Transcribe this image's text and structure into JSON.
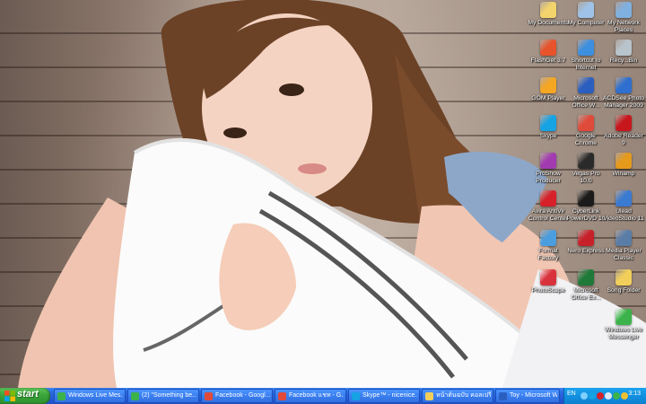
{
  "desktop_icons": [
    {
      "key": "my-documents",
      "label": "My Documents",
      "icon": "folder-documents-icon",
      "color": "#f3d36b"
    },
    {
      "key": "my-computer",
      "label": "My Computer",
      "icon": "computer-icon",
      "color": "#9fc3e8"
    },
    {
      "key": "my-network-places",
      "label": "My Network\nPlaces",
      "icon": "network-icon",
      "color": "#7fb0e0"
    },
    {
      "key": "flashget",
      "label": "FlashGet 3.7",
      "icon": "flashget-icon",
      "color": "#e8532b"
    },
    {
      "key": "shortcut-internet",
      "label": "Shortcut to\nInternet",
      "icon": "internet-explorer-icon",
      "color": "#3d8fe0"
    },
    {
      "key": "recycle-bin",
      "label": "Recy...Bin",
      "icon": "recycle-bin-icon",
      "color": "#b8c4cc"
    },
    {
      "key": "gom-player",
      "label": "GOM Player",
      "icon": "gom-player-icon",
      "color": "#f5a623"
    },
    {
      "key": "microsoft-office",
      "label": "Microsoft\nOffice W...",
      "icon": "word-icon",
      "color": "#2b5fbf"
    },
    {
      "key": "acdsee",
      "label": "ACDSee Photo\nManager 2009",
      "icon": "acdsee-icon",
      "color": "#2f6fcf"
    },
    {
      "key": "skype",
      "label": "Skype",
      "icon": "skype-icon",
      "color": "#16a3e4"
    },
    {
      "key": "google-chrome",
      "label": "Google\nChrome",
      "icon": "chrome-icon",
      "color": "#e04a3a"
    },
    {
      "key": "adobe-reader",
      "label": "Adobe Reader\n9",
      "icon": "adobe-reader-icon",
      "color": "#c8161d"
    },
    {
      "key": "proshow",
      "label": "ProShow\nProducer",
      "icon": "proshow-icon",
      "color": "#a23bb0"
    },
    {
      "key": "vegas-pro",
      "label": "Vegas Pro\n10.0",
      "icon": "vegas-icon",
      "color": "#2a2a2a"
    },
    {
      "key": "winamp",
      "label": "Winamp",
      "icon": "winamp-icon",
      "color": "#e59a1c"
    },
    {
      "key": "avira",
      "label": "Avira AntiVir\nControl Center",
      "icon": "avira-icon",
      "color": "#d7202a"
    },
    {
      "key": "cyberlink",
      "label": "CyberLink\nPowerDVD 10",
      "icon": "powerdvd-icon",
      "color": "#1b1b1b"
    },
    {
      "key": "ulead",
      "label": "Ulead\nVideoStudio 11",
      "icon": "ulead-icon",
      "color": "#3a7ad0"
    },
    {
      "key": "format-factory",
      "label": "Format\nFactory",
      "icon": "format-factory-icon",
      "color": "#4a9ee0"
    },
    {
      "key": "nero-express",
      "label": "Nero Express",
      "icon": "nero-icon",
      "color": "#c8202a"
    },
    {
      "key": "media-player-classic",
      "label": "Media Player\nClassic",
      "icon": "media-player-icon",
      "color": "#5a7da8"
    },
    {
      "key": "photoscape",
      "label": "PhotoScape",
      "icon": "photoscape-icon",
      "color": "#d8323c"
    },
    {
      "key": "microsoft-office-excel",
      "label": "Microsoft\nOffice Ex...",
      "icon": "excel-icon",
      "color": "#1f7a3a"
    },
    {
      "key": "song-folder",
      "label": "Song Folder",
      "icon": "folder-icon",
      "color": "#f1cf5a"
    },
    {
      "key": "windows-live-messenger",
      "label": "Windows Live\nMessenger",
      "icon": "messenger-icon",
      "color": "#3cb34a"
    }
  ],
  "taskbar": {
    "start_label": "start",
    "tasks": [
      {
        "label": "Windows Live Mes...",
        "icon": "messenger-icon",
        "color": "#3cb34a",
        "active": false
      },
      {
        "label": "(2) \"Something be...",
        "icon": "messenger-chat-icon",
        "color": "#3cb34a",
        "active": false
      },
      {
        "label": "Facebook - Googl...",
        "icon": "chrome-icon",
        "color": "#e04a3a",
        "active": false
      },
      {
        "label": "Facebook แชท - G...",
        "icon": "chrome-icon",
        "color": "#e04a3a",
        "active": false
      },
      {
        "label": "Skype™ - nicenice...",
        "icon": "skype-icon",
        "color": "#16a3e4",
        "active": false
      },
      {
        "label": "หน้าต้นฉบับ คอลเปรีชั่นจัก...",
        "icon": "folder-icon",
        "color": "#f1cf5a",
        "active": false
      },
      {
        "label": "Toy - Microsoft Word",
        "icon": "word-icon",
        "color": "#2b5fbf",
        "active": false
      }
    ],
    "tray": {
      "language": "EN",
      "icons": [
        {
          "name": "network-tray-icon",
          "color": "#7fd0ff"
        },
        {
          "name": "skype-tray-icon",
          "color": "#16a3e4"
        },
        {
          "name": "avira-tray-icon",
          "color": "#d7202a"
        },
        {
          "name": "volume-tray-icon",
          "color": "#dfe9f7"
        },
        {
          "name": "messenger-tray-icon",
          "color": "#3cb34a"
        },
        {
          "name": "security-tray-icon",
          "color": "#f0c030"
        }
      ],
      "clock": "3:13"
    }
  }
}
